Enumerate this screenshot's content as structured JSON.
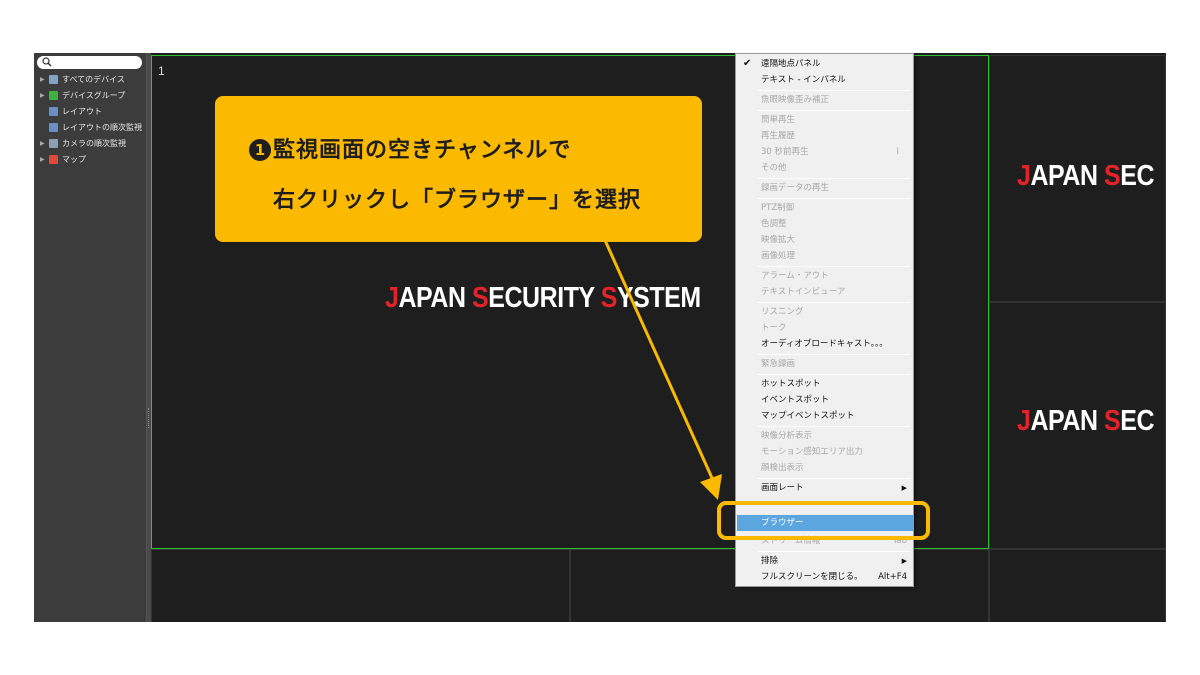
{
  "sidebar": {
    "items": [
      {
        "label": "すべてのデバイス",
        "icon": "device-list-icon",
        "color": "#7fa6c8"
      },
      {
        "label": "デバイスグループ",
        "icon": "device-group-icon",
        "color": "#3cb43c"
      },
      {
        "label": "レイアウト",
        "icon": "layout-icon",
        "color": "#6a8fc4"
      },
      {
        "label": "レイアウトの順次監視",
        "icon": "layout-sequence-icon",
        "color": "#6a8fc4"
      },
      {
        "label": "カメラの順次監視",
        "icon": "camera-sequence-icon",
        "color": "#8ca0b4"
      },
      {
        "label": "マップ",
        "icon": "map-icon",
        "color": "#e04a3a"
      }
    ]
  },
  "main_cell": {
    "number": "1",
    "logo": {
      "initial1": "J",
      "rest1": "APAN ",
      "initial2": "S",
      "rest2": "ECURITY ",
      "initial3": "S",
      "rest3": "YSTEM"
    }
  },
  "side_cells": {
    "logo": {
      "initial1": "J",
      "rest1": "APAN ",
      "initial2": "S",
      "rest2": "EC"
    }
  },
  "callout": {
    "number": "1",
    "line1": "監視画面の空きチャンネルで",
    "line2": "右クリックし「ブラウザー」を選択",
    "color": "#fbb900"
  },
  "context_menu": {
    "items": [
      {
        "label": "遠隔地点パネル",
        "checked": true,
        "disabled": false
      },
      {
        "label": "テキスト - インパネル",
        "disabled": false
      },
      {
        "label": "魚眼映像歪み補正",
        "disabled": true
      },
      {
        "label": "簡単再生",
        "disabled": true
      },
      {
        "label": "再生履歴",
        "disabled": true
      },
      {
        "label": "30 秒前再生",
        "shortcut": "I",
        "disabled": true
      },
      {
        "label": "その他",
        "disabled": true
      },
      {
        "label": "録画データの再生",
        "disabled": true
      },
      {
        "label": "PTZ制御",
        "disabled": true
      },
      {
        "label": "色調整",
        "disabled": true
      },
      {
        "label": "映像拡大",
        "disabled": true
      },
      {
        "label": "画像処理",
        "disabled": true
      },
      {
        "label": "アラーム・アウト",
        "disabled": true
      },
      {
        "label": "テキストインビューア",
        "disabled": true
      },
      {
        "label": "リスニング",
        "disabled": true
      },
      {
        "label": "トーク",
        "disabled": true
      },
      {
        "label": "オーディオブロードキャスト。。。",
        "disabled": false
      },
      {
        "label": "緊急録画",
        "disabled": true
      },
      {
        "label": "ホットスポット",
        "disabled": false
      },
      {
        "label": "イベントスポット",
        "disabled": false
      },
      {
        "label": "マップイベントスポット",
        "disabled": false
      },
      {
        "label": "映像分析表示",
        "disabled": true
      },
      {
        "label": "モーション感知エリア出力",
        "disabled": true
      },
      {
        "label": "顔検出表示",
        "disabled": true
      },
      {
        "label": "画面レート",
        "submenu": true,
        "disabled": false
      },
      {
        "label": "ブラウザー",
        "highlighted": true,
        "disabled": false
      },
      {
        "label": "ストリーム情報",
        "shortcut": "Tab",
        "disabled": true
      },
      {
        "label": "排除",
        "submenu": true,
        "disabled": false
      },
      {
        "label": "フルスクリーンを閉じる。",
        "shortcut": "Alt+F4",
        "disabled": false
      }
    ],
    "highlight_color": "#5ca6e0"
  },
  "colors": {
    "active_border": "#2fc42f",
    "logo_red": "#e3232a",
    "annotation": "#fbb900"
  }
}
